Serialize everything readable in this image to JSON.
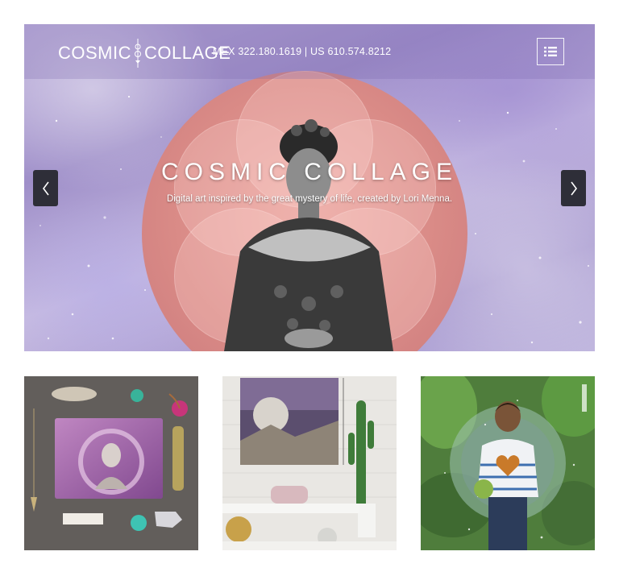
{
  "header": {
    "logo_left": "COSMIC",
    "logo_right": "COLLAGE",
    "phones": "MEX 322.180.1619 | US 610.574.8212",
    "menu_icon": "list-menu-icon"
  },
  "hero": {
    "title": "COSMIC COLLAGE",
    "subtitle": "Digital art inspired by the great mystery of life, created by Lori Menna.",
    "prev_icon": "chevron-left-icon",
    "next_icon": "chevron-right-icon"
  },
  "gallery": {
    "items": [
      {
        "name": "pouch-product-flatlay"
      },
      {
        "name": "canvas-wall-art-room"
      },
      {
        "name": "boy-portrait-collage"
      }
    ]
  },
  "colors": {
    "arrow_bg": "#2e2e38",
    "circle_pink": "#d98a86",
    "sky_lavender": "#b7a9d8"
  }
}
